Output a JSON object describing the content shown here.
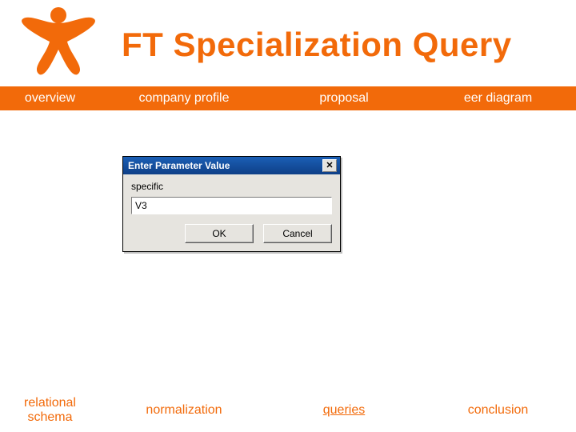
{
  "title": "FT Specialization Query",
  "nav_top": [
    {
      "label": "overview"
    },
    {
      "label": "company profile"
    },
    {
      "label": "proposal"
    },
    {
      "label": "eer diagram"
    }
  ],
  "nav_bottom": [
    {
      "label": "relational schema"
    },
    {
      "label": "normalization"
    },
    {
      "label": "queries"
    },
    {
      "label": "conclusion"
    }
  ],
  "dialog": {
    "title": "Enter Parameter Value",
    "close_glyph": "✕",
    "prompt": "specific",
    "value": "V3",
    "ok_label": "OK",
    "cancel_label": "Cancel"
  }
}
